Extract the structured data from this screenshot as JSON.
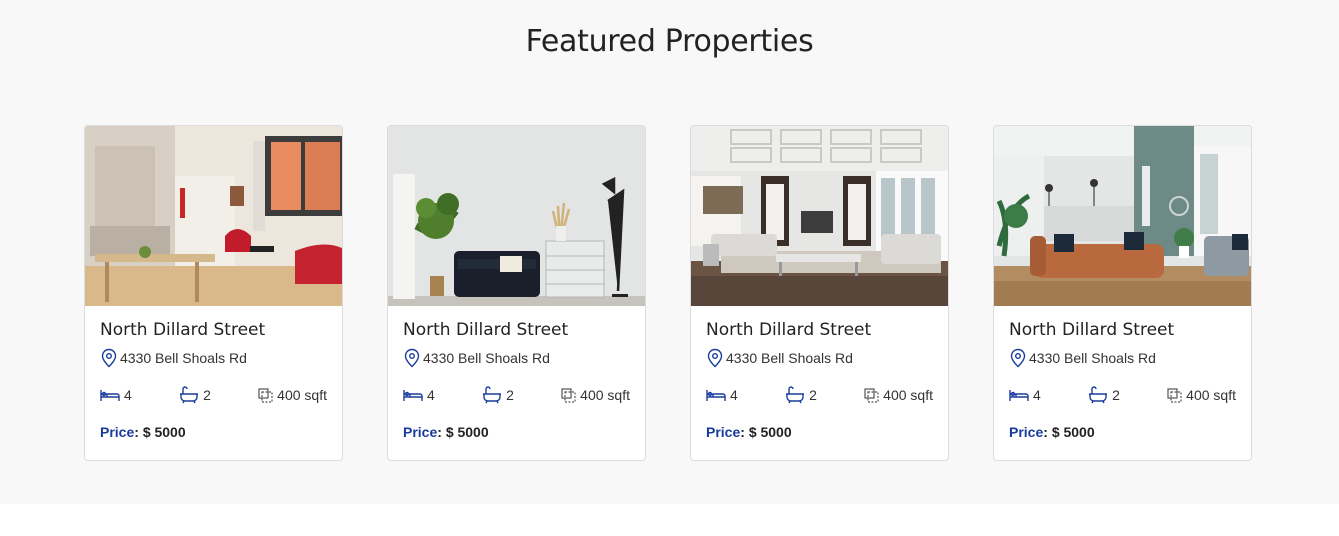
{
  "section": {
    "title": "Featured Properties"
  },
  "colors": {
    "accent": "#1a3b9c",
    "background": "#f8f8f8"
  },
  "cards": [
    {
      "name": "North Dillard Street",
      "address": "4330 Bell Shoals Rd",
      "beds": "4",
      "baths": "2",
      "area": "400 sqft",
      "price_label": "Price",
      "price": "$ 5000",
      "image": "bright-apartment-kitchen-living-room"
    },
    {
      "name": "North Dillard Street",
      "address": "4330 Bell Shoals Rd",
      "beds": "4",
      "baths": "2",
      "area": "400 sqft",
      "price_label": "Price",
      "price": "$ 5000",
      "image": "grey-wall-navy-sofa-dresser-lamp"
    },
    {
      "name": "North Dillard Street",
      "address": "4330 Bell Shoals Rd",
      "beds": "4",
      "baths": "2",
      "area": "400 sqft",
      "price_label": "Price",
      "price": "$ 5000",
      "image": "coffered-ceiling-living-room-fireplace"
    },
    {
      "name": "North Dillard Street",
      "address": "4330 Bell Shoals Rd",
      "beds": "4",
      "baths": "2",
      "area": "400 sqft",
      "price_label": "Price",
      "price": "$ 5000",
      "image": "open-plan-loft-tan-leather-sofa"
    }
  ],
  "icons": {
    "address": "map-pin-icon",
    "beds": "bed-icon",
    "baths": "bathtub-icon",
    "area": "area-icon"
  }
}
